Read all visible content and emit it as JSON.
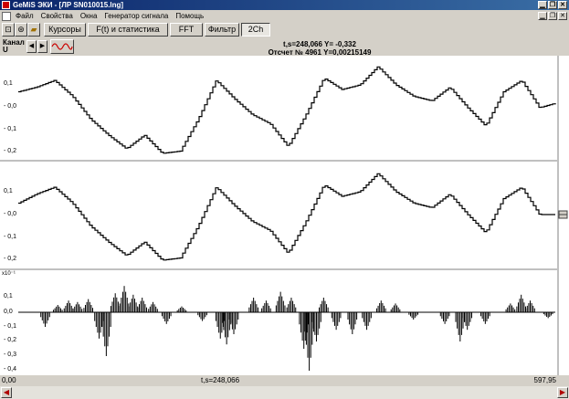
{
  "window": {
    "title": "GeMiS ЭКИ - [ЛР SN010015.lng]"
  },
  "menu": {
    "items": [
      "Файл",
      "Свойства",
      "Окна",
      "Генератор сигнала",
      "Помощь"
    ]
  },
  "toolbar": {
    "cursors": "Курсоры",
    "stats": "F(t) и статистика",
    "fft": "FFT",
    "filter": "Фильтр",
    "two_ch": "2Ch"
  },
  "info": {
    "channel_label": "Канал",
    "channel_value": "U",
    "cursor_readout": "t,s=248,066  Y= -0,332",
    "sample_readout": "Отсчет № 4961 Y=0,00215149"
  },
  "axes": {
    "top_ticks": [
      "0,1",
      "- 0,0",
      "- 0,1",
      "- 0,2"
    ],
    "mid_ticks": [
      "0,1",
      "- 0,0",
      "- 0,1",
      "- 0,2"
    ],
    "bottom_exponent": "x10⁻¹",
    "bottom_ticks": [
      "0,1",
      "0,0",
      "- 0,1",
      "- 0,2",
      "- 0,3",
      "- 0,4"
    ],
    "x_start": "0,00",
    "x_cursor": "t,s=248,066",
    "x_end": "597,95"
  },
  "chart_data": {
    "type": "line",
    "xlim": [
      0,
      597.95
    ],
    "cursor_x": 248.066,
    "series": [
      {
        "x": [
          0,
          20,
          40,
          60,
          80,
          100,
          120,
          140,
          160,
          180,
          200,
          220,
          240,
          260,
          280,
          300,
          320,
          340,
          360,
          380,
          400,
          420,
          440,
          460,
          480,
          500,
          520,
          540,
          560,
          580,
          597.95
        ],
        "values": [
          0.07,
          0.09,
          0.12,
          0.05,
          -0.05,
          -0.12,
          -0.18,
          -0.12,
          -0.2,
          -0.19,
          -0.05,
          0.12,
          0.04,
          -0.03,
          -0.07,
          -0.17,
          -0.03,
          0.13,
          0.08,
          0.1,
          0.18,
          0.1,
          0.05,
          0.03,
          0.09,
          0.0,
          -0.08,
          0.07,
          0.12,
          0.0,
          0.02
        ]
      },
      {
        "x": [
          0,
          20,
          40,
          60,
          80,
          100,
          120,
          140,
          160,
          180,
          200,
          220,
          240,
          260,
          280,
          300,
          320,
          340,
          360,
          380,
          400,
          420,
          440,
          460,
          480,
          500,
          520,
          540,
          560,
          580,
          597.95
        ],
        "values": [
          0.05,
          0.09,
          0.12,
          0.05,
          -0.05,
          -0.12,
          -0.18,
          -0.12,
          -0.2,
          -0.19,
          -0.05,
          0.12,
          0.04,
          -0.03,
          -0.07,
          -0.17,
          -0.03,
          0.13,
          0.08,
          0.1,
          0.18,
          0.1,
          0.05,
          0.03,
          0.09,
          0.0,
          -0.08,
          0.07,
          0.12,
          0.0,
          0.0
        ]
      },
      {
        "bursts": [
          {
            "x": 30,
            "y": -0.1
          },
          {
            "x": 44,
            "y": 0.05
          },
          {
            "x": 56,
            "y": 0.08
          },
          {
            "x": 66,
            "y": 0.07
          },
          {
            "x": 78,
            "y": 0.09
          },
          {
            "x": 90,
            "y": -0.18
          },
          {
            "x": 98,
            "y": -0.3
          },
          {
            "x": 108,
            "y": 0.13
          },
          {
            "x": 118,
            "y": 0.18
          },
          {
            "x": 128,
            "y": 0.12
          },
          {
            "x": 138,
            "y": 0.1
          },
          {
            "x": 150,
            "y": 0.07
          },
          {
            "x": 165,
            "y": -0.08
          },
          {
            "x": 182,
            "y": 0.04
          },
          {
            "x": 205,
            "y": -0.06
          },
          {
            "x": 225,
            "y": -0.18
          },
          {
            "x": 232,
            "y": -0.22
          },
          {
            "x": 240,
            "y": -0.15
          },
          {
            "x": 262,
            "y": 0.1
          },
          {
            "x": 276,
            "y": 0.08
          },
          {
            "x": 292,
            "y": 0.14
          },
          {
            "x": 304,
            "y": 0.1
          },
          {
            "x": 318,
            "y": -0.25
          },
          {
            "x": 324,
            "y": -0.4
          },
          {
            "x": 332,
            "y": -0.2
          },
          {
            "x": 340,
            "y": 0.1
          },
          {
            "x": 354,
            "y": -0.12
          },
          {
            "x": 372,
            "y": -0.15
          },
          {
            "x": 388,
            "y": -0.12
          },
          {
            "x": 404,
            "y": 0.08
          },
          {
            "x": 420,
            "y": 0.06
          },
          {
            "x": 440,
            "y": -0.05
          },
          {
            "x": 475,
            "y": -0.08
          },
          {
            "x": 492,
            "y": -0.2
          },
          {
            "x": 500,
            "y": -0.12
          },
          {
            "x": 520,
            "y": -0.08
          },
          {
            "x": 548,
            "y": 0.06
          },
          {
            "x": 560,
            "y": 0.12
          },
          {
            "x": 570,
            "y": 0.08
          },
          {
            "x": 590,
            "y": -0.04
          }
        ]
      }
    ]
  }
}
